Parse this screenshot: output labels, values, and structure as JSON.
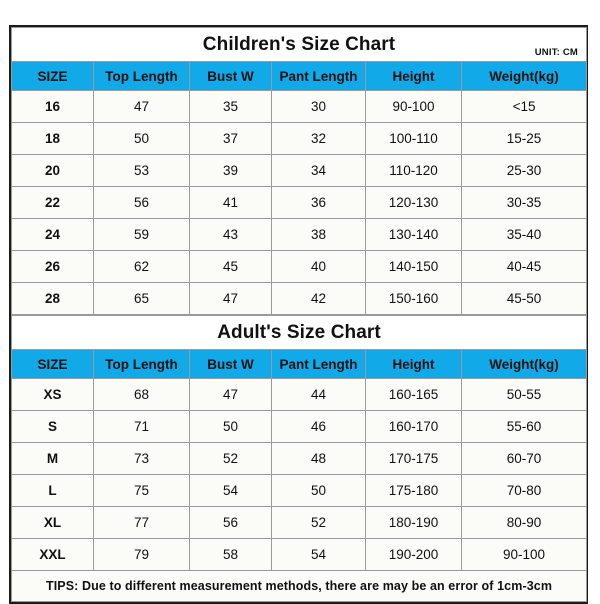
{
  "columns": [
    "SIZE",
    "Top Length",
    "Bust W",
    "Pant Length",
    "Height",
    "Weight(kg)"
  ],
  "children": {
    "title": "Children's Size Chart",
    "unit": "UNIT: CM",
    "rows": [
      [
        "16",
        "47",
        "35",
        "30",
        "90-100",
        "<15"
      ],
      [
        "18",
        "50",
        "37",
        "32",
        "100-110",
        "15-25"
      ],
      [
        "20",
        "53",
        "39",
        "34",
        "110-120",
        "25-30"
      ],
      [
        "22",
        "56",
        "41",
        "36",
        "120-130",
        "30-35"
      ],
      [
        "24",
        "59",
        "43",
        "38",
        "130-140",
        "35-40"
      ],
      [
        "26",
        "62",
        "45",
        "40",
        "140-150",
        "40-45"
      ],
      [
        "28",
        "65",
        "47",
        "42",
        "150-160",
        "45-50"
      ]
    ]
  },
  "adult": {
    "title": "Adult's Size Chart",
    "rows": [
      [
        "XS",
        "68",
        "47",
        "44",
        "160-165",
        "50-55"
      ],
      [
        "S",
        "71",
        "50",
        "46",
        "160-170",
        "55-60"
      ],
      [
        "M",
        "73",
        "52",
        "48",
        "170-175",
        "60-70"
      ],
      [
        "L",
        "75",
        "54",
        "50",
        "175-180",
        "70-80"
      ],
      [
        "XL",
        "77",
        "56",
        "52",
        "180-190",
        "80-90"
      ],
      [
        "XXL",
        "79",
        "58",
        "54",
        "190-200",
        "90-100"
      ]
    ]
  },
  "tips": "TIPS: Due to different measurement methods, there are may be an error of 1cm-3cm",
  "colors": {
    "header_blue": "#12a9e8",
    "tips_red": "#f01414",
    "border_dark": "#1c1c1c",
    "grid_gray": "#9a9a9a",
    "cell_bg": "#fbfbf8"
  }
}
